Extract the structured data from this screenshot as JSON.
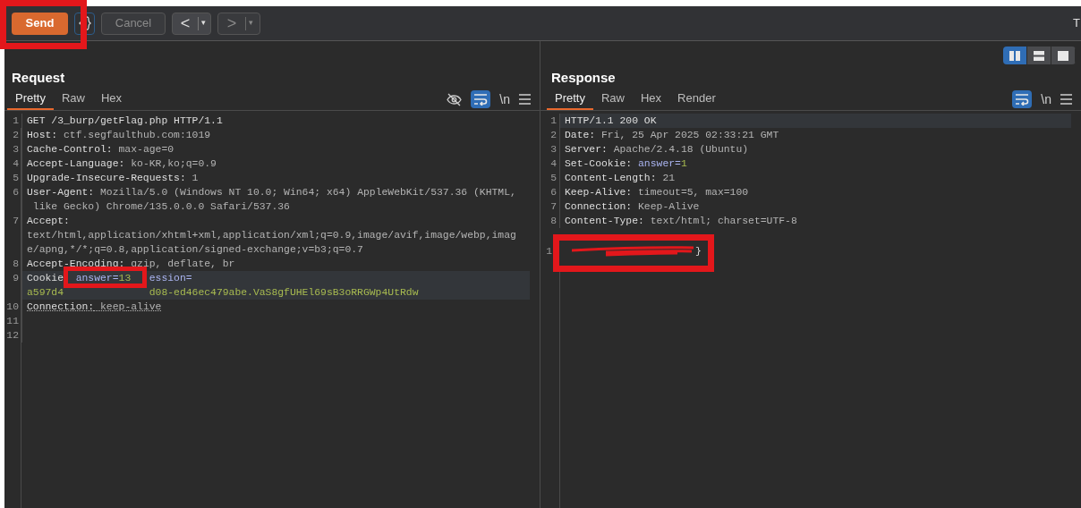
{
  "toolbar": {
    "send": "Send",
    "cancel": "Cancel",
    "cancel_disabled": true,
    "back": "<",
    "forward": ">",
    "forward_disabled": true,
    "dropdown_caret": "▾",
    "right_label": "T"
  },
  "layout_options": [
    {
      "selected": true
    },
    {
      "selected": false
    },
    {
      "selected": false
    }
  ],
  "request": {
    "title": "Request",
    "tabs": [
      {
        "label": "Pretty",
        "selected": true
      },
      {
        "label": "Raw",
        "selected": false
      },
      {
        "label": "Hex",
        "selected": false
      }
    ],
    "hide_nonprintable": true,
    "wrap_lines": true,
    "newline_label": "\\n",
    "lines": [
      {
        "number": "1",
        "rows": [
          [
            {
              "text": "GET /3_burp/getFlag.php HTTP/1.1",
              "kind": "key"
            }
          ]
        ]
      },
      {
        "number": "2",
        "rows": [
          [
            {
              "text": "Host:",
              "kind": "key"
            },
            {
              "text": " ctf.segfaulthub.com:1019",
              "kind": "value"
            }
          ]
        ]
      },
      {
        "number": "3",
        "rows": [
          [
            {
              "text": "Cache-Control:",
              "kind": "key"
            },
            {
              "text": " max-age=0",
              "kind": "value"
            }
          ]
        ]
      },
      {
        "number": "4",
        "rows": [
          [
            {
              "text": "Accept-Language:",
              "kind": "key"
            },
            {
              "text": " ko-KR,ko;q=0.9",
              "kind": "value"
            }
          ]
        ]
      },
      {
        "number": "5",
        "rows": [
          [
            {
              "text": "Upgrade-Insecure-Requests:",
              "kind": "key"
            },
            {
              "text": " 1",
              "kind": "value"
            }
          ]
        ]
      },
      {
        "number": "6",
        "rows": [
          [
            {
              "text": "User-Agent:",
              "kind": "key"
            },
            {
              "text": " Mozilla/5.0 (Windows NT 10.0; Win64; x64) AppleWebKit/537.36 (KHTML,",
              "kind": "value"
            }
          ],
          [
            {
              "text": " like Gecko) Chrome/135.0.0.0 Safari/537.36",
              "kind": "value"
            }
          ]
        ]
      },
      {
        "number": "7",
        "rows": [
          [
            {
              "text": "Accept:",
              "kind": "key"
            }
          ],
          [
            {
              "text": "text/html,application/xhtml+xml,application/xml;q=0.9,image/avif,image/webp,imag",
              "kind": "value"
            }
          ],
          [
            {
              "text": "e/apng,*/*;q=0.8,application/signed-exchange;v=b3;q=0.7",
              "kind": "value"
            }
          ]
        ]
      },
      {
        "number": "8",
        "rows": [
          [
            {
              "text": "Accept-Encoding:",
              "kind": "key"
            },
            {
              "text": " gzip, deflate, br",
              "kind": "value"
            }
          ]
        ]
      },
      {
        "number": "9",
        "current": true,
        "rows": [
          [
            {
              "text": "Cookie",
              "kind": "key"
            },
            {
              "text": "  answer=",
              "kind": "cookie_name"
            },
            {
              "text": "13",
              "kind": "cookie_value"
            },
            {
              "text": "   ession=",
              "kind": "cookie_name"
            }
          ],
          [
            {
              "text": "a597d4              d08-ed46ec479abe.VaS8gfUHEl69sB3oRRGWp4UtRdw",
              "kind": "cookie_value"
            }
          ]
        ]
      },
      {
        "number": "10",
        "flagged": true,
        "rows": [
          [
            {
              "text": "Connection:",
              "kind": "key"
            },
            {
              "text": " keep-alive",
              "kind": "value"
            }
          ]
        ]
      },
      {
        "number": "11",
        "rows": [
          []
        ]
      },
      {
        "number": "12",
        "rows": [
          []
        ]
      }
    ]
  },
  "response": {
    "title": "Response",
    "tabs": [
      {
        "label": "Pretty",
        "selected": true
      },
      {
        "label": "Raw",
        "selected": false
      },
      {
        "label": "Hex",
        "selected": false
      },
      {
        "label": "Render",
        "selected": false
      }
    ],
    "wrap_lines": true,
    "newline_label": "\\n",
    "lines": [
      {
        "number": "1",
        "current": true,
        "rows": [
          [
            {
              "text": "HTTP/1.1 200 OK",
              "kind": "key"
            }
          ]
        ]
      },
      {
        "number": "2",
        "rows": [
          [
            {
              "text": "Date:",
              "kind": "key"
            },
            {
              "text": " Fri, 25 Apr 2025 02:33:21 GMT",
              "kind": "value"
            }
          ]
        ]
      },
      {
        "number": "3",
        "rows": [
          [
            {
              "text": "Server:",
              "kind": "key"
            },
            {
              "text": " Apache/2.4.18 (Ubuntu)",
              "kind": "value"
            }
          ]
        ]
      },
      {
        "number": "4",
        "rows": [
          [
            {
              "text": "Set-Cookie:",
              "kind": "key"
            },
            {
              "text": " answer=",
              "kind": "cookie_name"
            },
            {
              "text": "1",
              "kind": "cookie_value"
            }
          ]
        ]
      },
      {
        "number": "5",
        "rows": [
          [
            {
              "text": "Content-Length:",
              "kind": "key"
            },
            {
              "text": " 21",
              "kind": "value"
            }
          ]
        ]
      },
      {
        "number": "6",
        "rows": [
          [
            {
              "text": "Keep-Alive:",
              "kind": "key"
            },
            {
              "text": " timeout=5, max=100",
              "kind": "value"
            }
          ]
        ]
      },
      {
        "number": "7",
        "rows": [
          [
            {
              "text": "Connection:",
              "kind": "key"
            },
            {
              "text": " Keep-Alive",
              "kind": "value"
            }
          ]
        ]
      },
      {
        "number": "8",
        "rows": [
          [
            {
              "text": "Content-Type:",
              "kind": "key"
            },
            {
              "text": " text/html; charset=UTF-8",
              "kind": "value"
            }
          ]
        ]
      }
    ],
    "body": {
      "number": "1",
      "text": "}",
      "redacted": true
    }
  }
}
